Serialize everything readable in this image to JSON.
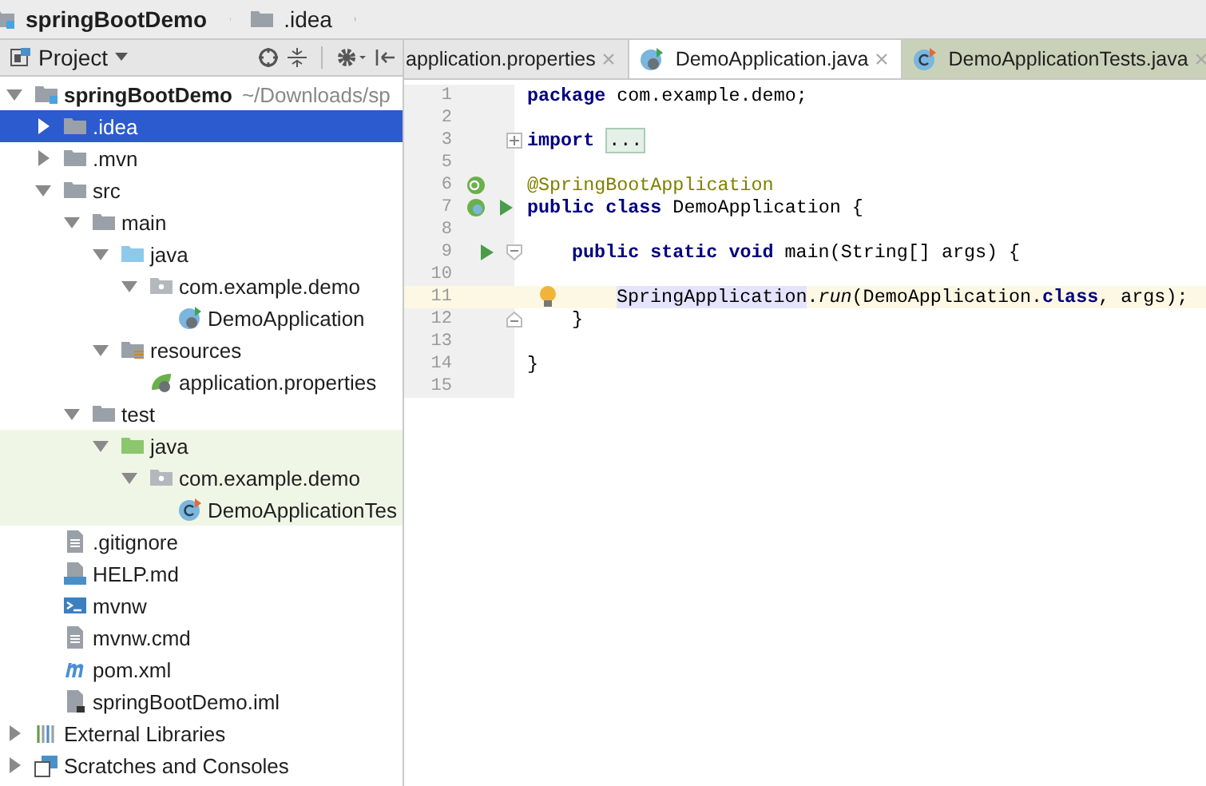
{
  "breadcrumbs": [
    {
      "label": "springBootDemo",
      "kind": "module"
    },
    {
      "label": ".idea",
      "kind": "folder"
    }
  ],
  "project_panel": {
    "title": "Project",
    "tree": [
      {
        "label": "springBootDemo",
        "hint": "~/Downloads/sp",
        "kind": "module",
        "expanded": true,
        "selected": false,
        "highlighted": false,
        "children": [
          {
            "label": ".idea",
            "kind": "folder",
            "expanded": false,
            "selected": true,
            "highlighted": false
          },
          {
            "label": ".mvn",
            "kind": "folder",
            "expanded": false,
            "selected": false,
            "highlighted": false
          },
          {
            "label": "src",
            "kind": "folder",
            "expanded": true,
            "selected": false,
            "highlighted": false,
            "children": [
              {
                "label": "main",
                "kind": "folder",
                "expanded": true,
                "selected": false,
                "highlighted": false,
                "children": [
                  {
                    "label": "java",
                    "kind": "source",
                    "expanded": true,
                    "selected": false,
                    "highlighted": false,
                    "children": [
                      {
                        "label": "com.example.demo",
                        "kind": "package",
                        "expanded": true,
                        "selected": false,
                        "highlighted": false,
                        "children": [
                          {
                            "label": "DemoApplication",
                            "kind": "class",
                            "selected": false,
                            "highlighted": false
                          }
                        ]
                      }
                    ]
                  },
                  {
                    "label": "resources",
                    "kind": "resources",
                    "expanded": true,
                    "selected": false,
                    "highlighted": false,
                    "children": [
                      {
                        "label": "application.properties",
                        "kind": "properties",
                        "selected": false,
                        "highlighted": false
                      }
                    ]
                  }
                ]
              },
              {
                "label": "test",
                "kind": "folder",
                "expanded": true,
                "selected": false,
                "highlighted": false,
                "children": [
                  {
                    "label": "java",
                    "kind": "tests",
                    "expanded": true,
                    "selected": false,
                    "highlighted": true,
                    "children": [
                      {
                        "label": "com.example.demo",
                        "kind": "package",
                        "expanded": true,
                        "selected": false,
                        "highlighted": true,
                        "children": [
                          {
                            "label": "DemoApplicationTes",
                            "kind": "testclass",
                            "selected": false,
                            "highlighted": true
                          }
                        ]
                      }
                    ]
                  }
                ]
              }
            ]
          },
          {
            "label": ".gitignore",
            "kind": "text",
            "selected": false,
            "highlighted": false
          },
          {
            "label": "HELP.md",
            "kind": "markdown",
            "selected": false,
            "highlighted": false
          },
          {
            "label": "mvnw",
            "kind": "shell",
            "selected": false,
            "highlighted": false
          },
          {
            "label": "mvnw.cmd",
            "kind": "text",
            "selected": false,
            "highlighted": false
          },
          {
            "label": "pom.xml",
            "kind": "maven",
            "selected": false,
            "highlighted": false
          },
          {
            "label": "springBootDemo.iml",
            "kind": "iml",
            "selected": false,
            "highlighted": false
          }
        ]
      },
      {
        "label": "External Libraries",
        "kind": "libraries",
        "expanded": false,
        "selected": false,
        "highlighted": false
      },
      {
        "label": "Scratches and Consoles",
        "kind": "scratches",
        "expanded": false,
        "selected": false,
        "highlighted": false
      }
    ]
  },
  "tabs": [
    {
      "label": "application.properties",
      "kind": "plain",
      "selected": false,
      "test": false
    },
    {
      "label": "DemoApplication.java",
      "kind": "class",
      "selected": true,
      "test": false
    },
    {
      "label": "DemoApplicationTests.java",
      "kind": "testclass",
      "selected": false,
      "test": true
    }
  ],
  "editor": {
    "lines": [
      {
        "number": "1",
        "current": false,
        "kind": "top",
        "tokens": [
          {
            "text": "package",
            "kind": "kw"
          },
          {
            "text": " com.example.demo;",
            "kind": "plain"
          }
        ]
      },
      {
        "number": "2",
        "current": false
      },
      {
        "number": "3",
        "current": false,
        "kind": "top",
        "fold": {
          "kind": "expand"
        },
        "tokens": [
          {
            "text": "import",
            "kind": "kw"
          },
          {
            "text": "...",
            "kind": "folded"
          }
        ]
      },
      {
        "number": "5",
        "current": false
      },
      {
        "number": "6",
        "current": false,
        "kind": "top",
        "markers": [
          {
            "kind": "bean"
          }
        ],
        "tokens": [
          {
            "text": "@SpringBootApplication",
            "kind": "annotation"
          }
        ]
      },
      {
        "number": "7",
        "current": false,
        "kind": "top",
        "markers": [
          {
            "kind": "class"
          },
          {
            "kind": "run"
          }
        ],
        "tokens": [
          {
            "text": "public class",
            "kind": "kw"
          },
          {
            "text": " DemoApplication {",
            "kind": "plain"
          }
        ]
      },
      {
        "number": "8",
        "current": false
      },
      {
        "number": "9",
        "current": false,
        "kind": "member",
        "fold": {
          "kind": "collapse"
        },
        "markers": [
          {
            "kind": "run"
          }
        ],
        "tokens": [
          {
            "text": "public static void",
            "kind": "kw"
          },
          {
            "text": " main(String[] args) {",
            "kind": "plain"
          }
        ]
      },
      {
        "number": "10",
        "current": false
      },
      {
        "number": "11",
        "current": true,
        "kind": "body",
        "markers": [
          {
            "kind": "bulb"
          }
        ],
        "tokens": [
          {
            "text": "SpringApplication",
            "kind": "usage"
          },
          {
            "text": ".",
            "kind": "plain"
          },
          {
            "text": "run",
            "kind": "italic"
          },
          {
            "text": "(DemoApplication.",
            "kind": "plain"
          },
          {
            "text": "class",
            "kind": "kw"
          },
          {
            "text": ", args);",
            "kind": "plain"
          }
        ]
      },
      {
        "number": "12",
        "current": false,
        "kind": "member",
        "fold": {
          "kind": "end"
        },
        "tokens": [
          {
            "text": "}",
            "kind": "plain"
          }
        ]
      },
      {
        "number": "13",
        "current": false
      },
      {
        "number": "14",
        "current": false,
        "kind": "top",
        "tokens": [
          {
            "text": "}",
            "kind": "plain"
          }
        ]
      },
      {
        "number": "15",
        "current": false
      }
    ]
  }
}
